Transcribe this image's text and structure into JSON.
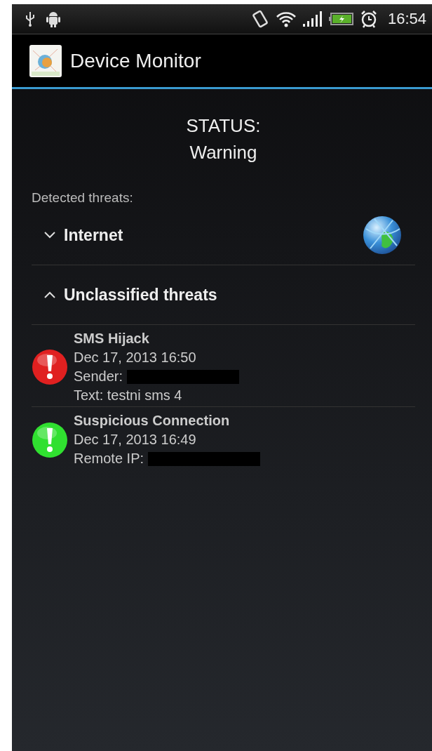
{
  "status_bar": {
    "time": "16:54"
  },
  "app_bar": {
    "title": "Device Monitor"
  },
  "status": {
    "label": "STATUS:",
    "value": "Warning"
  },
  "section_label": "Detected threats:",
  "groups": [
    {
      "title": "Internet",
      "expanded": false
    },
    {
      "title": "Unclassified threats",
      "expanded": true,
      "items": [
        {
          "title": "SMS Hijack",
          "color": "#e02020",
          "lines": [
            {
              "text": "Dec 17, 2013 16:50",
              "redacted": false
            },
            {
              "text": "Sender:",
              "redacted": true
            },
            {
              "text": "Text: testni sms 4",
              "redacted": false
            }
          ]
        },
        {
          "title": "Suspicious Connection",
          "color": "#30e030",
          "lines": [
            {
              "text": "Dec 17, 2013 16:49",
              "redacted": false
            },
            {
              "text": "Remote IP:",
              "redacted": true
            }
          ]
        }
      ]
    }
  ]
}
